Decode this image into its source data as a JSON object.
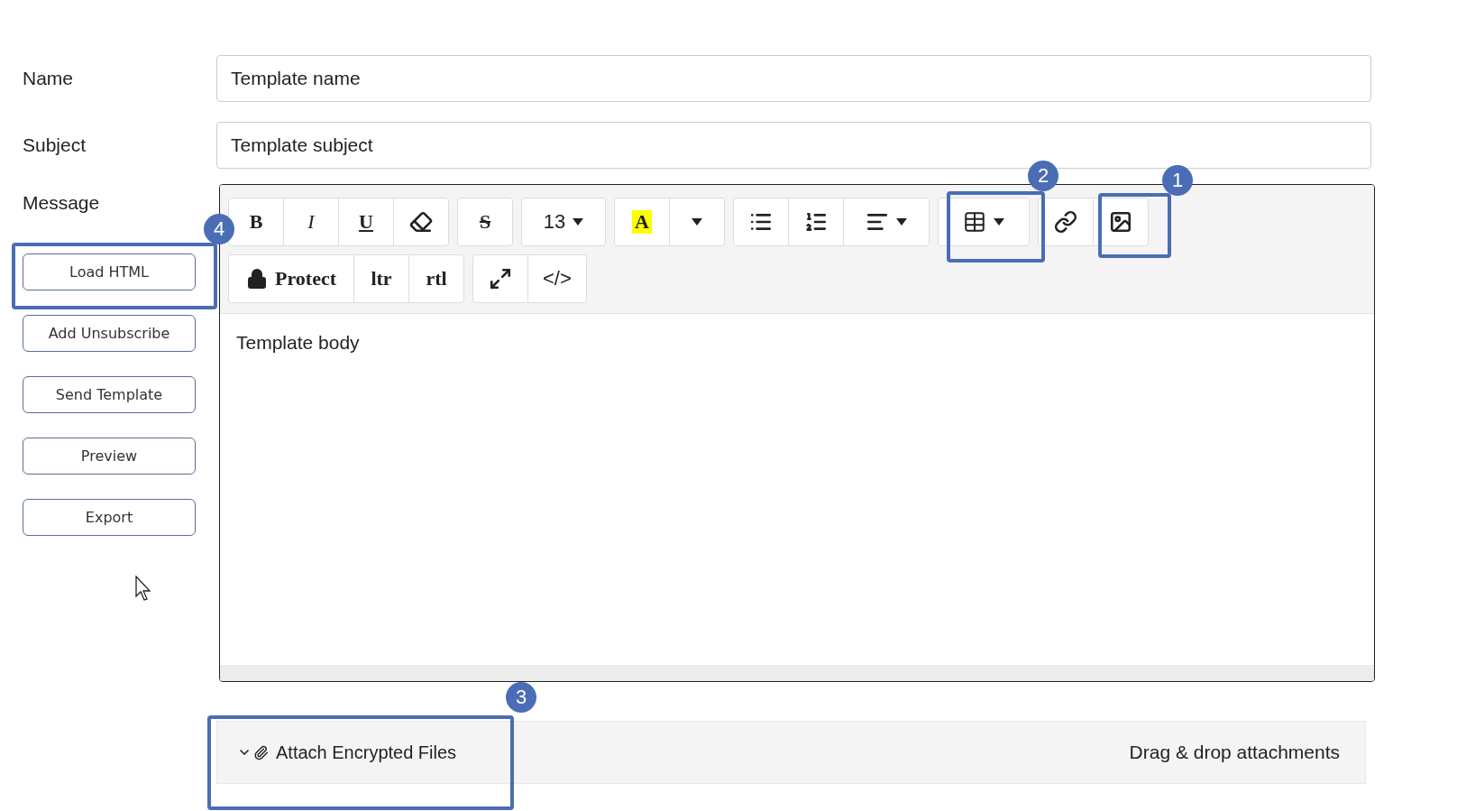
{
  "form": {
    "name": {
      "label": "Name",
      "value": "Template name"
    },
    "subject": {
      "label": "Subject",
      "value": "Template subject"
    },
    "message": {
      "label": "Message"
    }
  },
  "side_buttons": [
    "Load HTML",
    "Add Unsubscribe",
    "Send Template",
    "Preview",
    "Export"
  ],
  "toolbar": [
    [
      [
        {
          "kind": "bold",
          "text": "B"
        },
        {
          "kind": "italic",
          "text": "I"
        },
        {
          "kind": "underline",
          "text": "U"
        },
        {
          "kind": "eraser"
        }
      ],
      [
        {
          "kind": "strike",
          "text": "S"
        }
      ],
      [
        {
          "kind": "size",
          "text": "13",
          "dropdown": true
        }
      ],
      [
        {
          "kind": "highlight",
          "text": "A"
        },
        {
          "kind": "caret"
        }
      ],
      [
        {
          "kind": "bullets"
        },
        {
          "kind": "numbers"
        },
        {
          "kind": "align",
          "dropdown": true
        }
      ],
      [
        {
          "kind": "table",
          "dropdown": true
        }
      ],
      [
        {
          "kind": "link"
        },
        {
          "kind": "image"
        }
      ]
    ],
    [
      [
        {
          "kind": "protect",
          "text": "Protect"
        },
        {
          "kind": "serif",
          "text": "ltr"
        },
        {
          "kind": "serif",
          "text": "rtl"
        }
      ],
      [
        {
          "kind": "fullscreen"
        },
        {
          "kind": "code",
          "text": "</>"
        }
      ]
    ]
  ],
  "body": "Template body",
  "attachments": {
    "expanded": true,
    "label": "Attach Encrypted Files",
    "hint": "Drag & drop attachments"
  },
  "callouts": [
    {
      "number": "1"
    },
    {
      "number": "2"
    },
    {
      "number": "3"
    },
    {
      "number": "4"
    }
  ]
}
